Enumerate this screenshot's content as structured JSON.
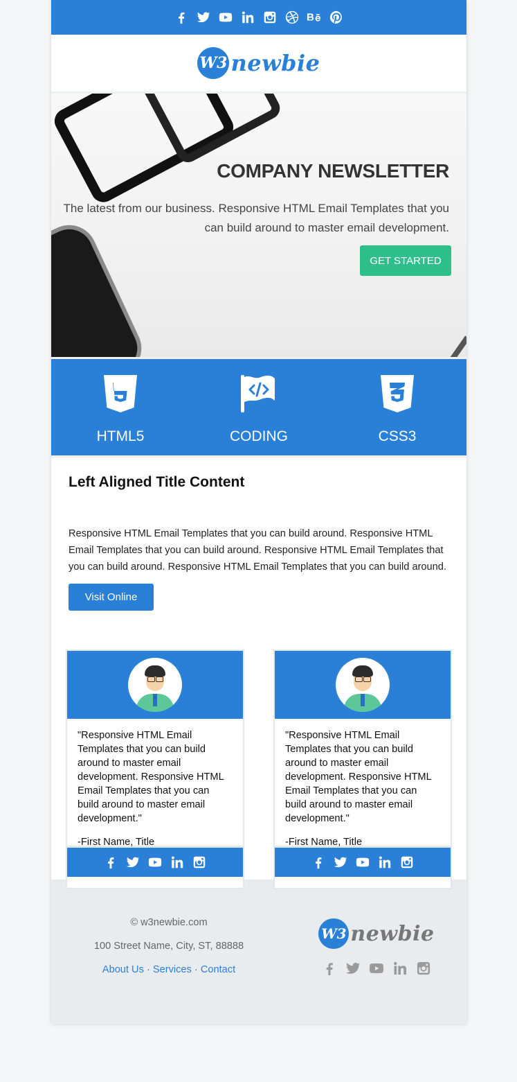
{
  "header": {
    "social_icons": [
      "facebook-icon",
      "twitter-icon",
      "youtube-icon",
      "linkedin-icon",
      "instagram-icon",
      "dribbble-icon",
      "behance-icon",
      "pinterest-icon"
    ],
    "logo_badge": "W3",
    "logo_word": "newbie"
  },
  "hero": {
    "title": "COMPANY NEWSLETTER",
    "text": "The latest from our business. Responsive HTML Email Templates that you can build around to master email development.",
    "button": "GET STARTED",
    "button_color": "#2fbf8a"
  },
  "features": [
    {
      "icon": "html5-icon",
      "label": "HTML5"
    },
    {
      "icon": "coding-flag-icon",
      "label": "CODING"
    },
    {
      "icon": "css3-icon",
      "label": "CSS3"
    }
  ],
  "content": {
    "title": "Left Aligned Title Content",
    "body": "Responsive HTML Email Templates that you can build around. Responsive HTML Email Templates that you can build around. Responsive HTML Email Templates that you can build around. Responsive HTML Email Templates that you can build around.",
    "button": "Visit Online"
  },
  "testimonials": [
    {
      "quote": "\"Responsive HTML Email Templates that you can build around to master email development. Responsive HTML Email Templates that you can build around to master email development.\"",
      "attribution": "-First Name, Title",
      "social_icons": [
        "facebook-icon",
        "twitter-icon",
        "youtube-icon",
        "linkedin-icon",
        "instagram-icon"
      ]
    },
    {
      "quote": "\"Responsive HTML Email Templates that you can build around to master email development. Responsive HTML Email Templates that you can build around to master email development.\"",
      "attribution": "-First Name, Title",
      "social_icons": [
        "facebook-icon",
        "twitter-icon",
        "youtube-icon",
        "linkedin-icon",
        "instagram-icon"
      ]
    }
  ],
  "footer": {
    "copyright": "© w3newbie.com",
    "address": "100 Street Name, City, ST, 88888",
    "links": [
      "About Us",
      "Services",
      "Contact"
    ],
    "separator": "·",
    "logo_badge": "W3",
    "logo_word": "newbie",
    "social_icons": [
      "facebook-icon",
      "twitter-icon",
      "youtube-icon",
      "linkedin-icon",
      "instagram-icon"
    ]
  },
  "colors": {
    "brand_blue": "#2a7fd6",
    "cta_green": "#2fbf8a",
    "footer_bg": "#e9ecef"
  }
}
